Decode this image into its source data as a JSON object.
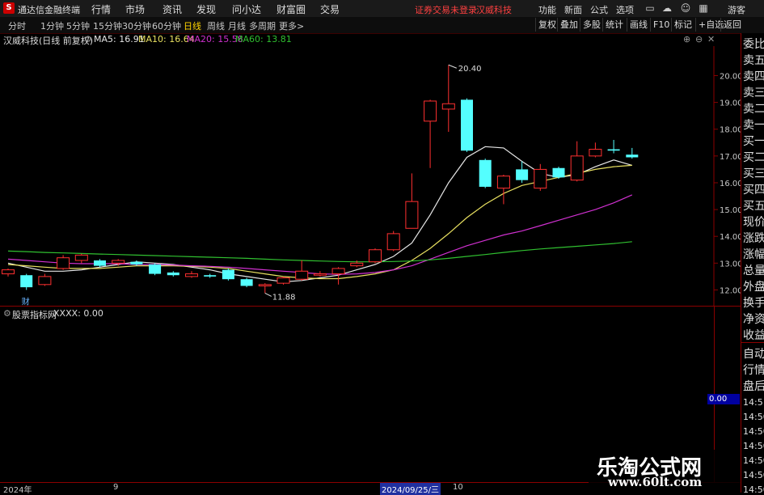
{
  "titlebar": {
    "app_name": "通达信金融终端",
    "menus": [
      "行情",
      "市场",
      "资讯",
      "发现",
      "问小达",
      "财富圈",
      "交易"
    ],
    "notice": "证券交易未登录",
    "stock": "汉威科技",
    "right_menus": [
      "功能",
      "新面",
      "公式",
      "选项"
    ],
    "guest": "游客"
  },
  "toolbar": {
    "periods": [
      "分时",
      "1分钟",
      "5分钟",
      "15分钟",
      "30分钟",
      "60分钟",
      "日线",
      "周线",
      "月线",
      "多周期",
      "更多>"
    ],
    "active_period": "日线",
    "right": [
      "复权",
      "叠加",
      "多股",
      "统计",
      "画线",
      "F10",
      "标记",
      "+自选",
      "返回"
    ]
  },
  "infobar": {
    "title": "汉威科技(日线 前复权)",
    "ma5": "MA5: 16.91",
    "ma10": "MA10: 16.64",
    "ma20": "MA20: 15.58",
    "ma60": "MA60: 13.81"
  },
  "colors": {
    "ma5": "#e6e6e6",
    "ma10": "#e8e060",
    "ma20": "#d030d0",
    "ma60": "#30c030",
    "up": "#ff3030",
    "down": "#54ffff"
  },
  "chart_data": {
    "type": "candlestick",
    "ylim": [
      11.5,
      20.8
    ],
    "y_ticks": [
      "20.00",
      "19.00",
      "18.00",
      "17.00",
      "16.00",
      "15.00",
      "14.00",
      "13.00",
      "12.00"
    ],
    "annotations": {
      "high": "20.40",
      "low": "11.88",
      "marker": "财"
    },
    "candles": [
      {
        "o": 12.6,
        "c": 12.75,
        "h": 12.8,
        "l": 12.5
      },
      {
        "o": 12.55,
        "c": 12.1,
        "h": 12.6,
        "l": 12.0
      },
      {
        "o": 12.2,
        "c": 12.5,
        "h": 12.6,
        "l": 12.15
      },
      {
        "o": 12.8,
        "c": 13.2,
        "h": 13.3,
        "l": 12.75
      },
      {
        "o": 13.1,
        "c": 13.3,
        "h": 13.35,
        "l": 13.0
      },
      {
        "o": 13.1,
        "c": 12.9,
        "h": 13.15,
        "l": 12.85
      },
      {
        "o": 13.0,
        "c": 13.1,
        "h": 13.15,
        "l": 12.9
      },
      {
        "o": 13.05,
        "c": 12.95,
        "h": 13.1,
        "l": 12.9
      },
      {
        "o": 12.95,
        "c": 12.6,
        "h": 13.0,
        "l": 12.55
      },
      {
        "o": 12.65,
        "c": 12.55,
        "h": 12.7,
        "l": 12.5
      },
      {
        "o": 12.5,
        "c": 12.6,
        "h": 12.7,
        "l": 12.45
      },
      {
        "o": 12.55,
        "c": 12.5,
        "h": 12.6,
        "l": 12.45
      },
      {
        "o": 12.75,
        "c": 12.4,
        "h": 12.8,
        "l": 12.35
      },
      {
        "o": 12.4,
        "c": 12.15,
        "h": 12.45,
        "l": 12.1
      },
      {
        "o": 12.15,
        "c": 12.2,
        "h": 12.25,
        "l": 11.88
      },
      {
        "o": 12.25,
        "c": 12.45,
        "h": 12.5,
        "l": 12.2
      },
      {
        "o": 12.4,
        "c": 12.7,
        "h": 13.1,
        "l": 12.35
      },
      {
        "o": 12.55,
        "c": 12.6,
        "h": 12.7,
        "l": 12.5
      },
      {
        "o": 12.6,
        "c": 12.8,
        "h": 12.85,
        "l": 12.2
      },
      {
        "o": 12.9,
        "c": 13.0,
        "h": 13.1,
        "l": 12.85
      },
      {
        "o": 13.05,
        "c": 13.5,
        "h": 13.55,
        "l": 13.0
      },
      {
        "o": 13.5,
        "c": 14.1,
        "h": 14.2,
        "l": 13.45
      },
      {
        "o": 14.3,
        "c": 15.3,
        "h": 16.35,
        "l": 14.3
      },
      {
        "o": 18.3,
        "c": 19.05,
        "h": 19.1,
        "l": 16.55
      },
      {
        "o": 18.75,
        "c": 18.95,
        "h": 20.4,
        "l": 17.9
      },
      {
        "o": 19.1,
        "c": 17.2,
        "h": 19.15,
        "l": 17.15
      },
      {
        "o": 16.85,
        "c": 15.85,
        "h": 16.9,
        "l": 15.8
      },
      {
        "o": 15.8,
        "c": 16.25,
        "h": 16.3,
        "l": 15.2
      },
      {
        "o": 16.5,
        "c": 16.1,
        "h": 16.8,
        "l": 16.0
      },
      {
        "o": 15.8,
        "c": 16.5,
        "h": 16.7,
        "l": 15.7
      },
      {
        "o": 16.55,
        "c": 16.2,
        "h": 16.6,
        "l": 16.15
      },
      {
        "o": 16.1,
        "c": 17.0,
        "h": 17.55,
        "l": 16.05
      },
      {
        "o": 17.0,
        "c": 17.25,
        "h": 17.5,
        "l": 16.95
      },
      {
        "o": 17.25,
        "c": 17.2,
        "h": 17.6,
        "l": 17.1
      },
      {
        "o": 17.05,
        "c": 16.95,
        "h": 17.3,
        "l": 16.9
      }
    ],
    "series": [
      {
        "name": "MA5",
        "values": [
          13.0,
          12.85,
          12.7,
          12.7,
          12.75,
          12.85,
          12.95,
          13.05,
          13.0,
          12.95,
          12.85,
          12.75,
          12.6,
          12.5,
          12.4,
          12.3,
          12.35,
          12.45,
          12.55,
          12.75,
          12.95,
          13.25,
          13.75,
          14.8,
          16.0,
          16.95,
          17.35,
          17.3,
          16.8,
          16.35,
          16.2,
          16.3,
          16.6,
          16.85,
          16.65
        ]
      },
      {
        "name": "MA10",
        "values": [
          12.95,
          12.9,
          12.85,
          12.8,
          12.8,
          12.8,
          12.85,
          12.9,
          12.9,
          12.9,
          12.88,
          12.85,
          12.8,
          12.7,
          12.6,
          12.5,
          12.45,
          12.42,
          12.42,
          12.5,
          12.6,
          12.75,
          13.1,
          13.55,
          14.1,
          14.7,
          15.2,
          15.6,
          15.9,
          16.05,
          16.2,
          16.35,
          16.5,
          16.6,
          16.65
        ]
      },
      {
        "name": "MA20",
        "values": [
          13.15,
          13.1,
          13.05,
          13.0,
          12.98,
          12.98,
          12.98,
          12.95,
          12.95,
          12.93,
          12.9,
          12.88,
          12.85,
          12.8,
          12.75,
          12.7,
          12.65,
          12.6,
          12.58,
          12.6,
          12.65,
          12.75,
          12.9,
          13.15,
          13.4,
          13.65,
          13.85,
          14.05,
          14.2,
          14.4,
          14.6,
          14.8,
          15.0,
          15.25,
          15.55
        ]
      },
      {
        "name": "MA60",
        "values": [
          13.45,
          13.43,
          13.4,
          13.38,
          13.36,
          13.34,
          13.32,
          13.3,
          13.28,
          13.26,
          13.24,
          13.22,
          13.2,
          13.18,
          13.15,
          13.12,
          13.1,
          13.08,
          13.06,
          13.05,
          13.05,
          13.06,
          13.08,
          13.12,
          13.18,
          13.25,
          13.32,
          13.4,
          13.47,
          13.53,
          13.58,
          13.63,
          13.68,
          13.73,
          13.8
        ]
      }
    ]
  },
  "right_panel": {
    "items": [
      "委比",
      "卖五",
      "卖四",
      "卖三",
      "卖二",
      "卖一",
      "买一",
      "买二",
      "买三",
      "买四",
      "买五",
      "现价",
      "涨跌",
      "涨幅",
      "总量",
      "外盘",
      "换手",
      "净资",
      "收益"
    ],
    "lower": [
      "自动",
      "行情",
      "盘后"
    ],
    "times": [
      "14:5",
      "14:50",
      "14:50",
      "14:50",
      "14:50",
      "14:50",
      "14:50"
    ],
    "ind_value": "0.00"
  },
  "indicator": {
    "name": "股票指标网",
    "line": "XXXX: 0.00"
  },
  "dateaxis": {
    "d1": "2024年",
    "d2": "9",
    "d3": "2024/09/25/三",
    "d4": "10"
  },
  "watermark": {
    "line1": "乐淘公式网",
    "line2": "www.60lt.com"
  }
}
